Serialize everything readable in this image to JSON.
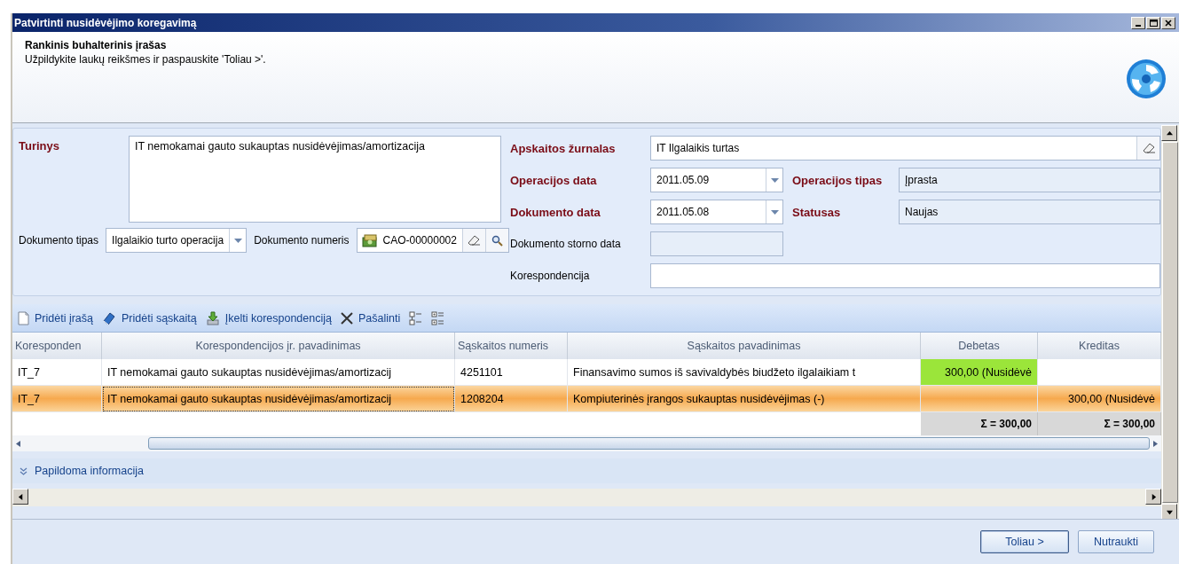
{
  "window": {
    "title": "Patvirtinti nusidėvėjimo koregavimą"
  },
  "header": {
    "title": "Rankinis buhalterinis įrašas",
    "subtitle": "Užpildykite laukų reikšmes ir paspauskite 'Toliau >'."
  },
  "form": {
    "content": {
      "label": "Turinys",
      "value": "IT nemokamai gauto sukauptas nusidėvėjimas/amortizacija",
      "required": true
    },
    "document_type": {
      "label": "Dokumento tipas",
      "value": "Ilgalaikio turto operacija",
      "required": false
    },
    "document_number": {
      "label": "Dokumento numeris",
      "value": "CAO-00000002",
      "required": false
    },
    "journal": {
      "label": "Apskaitos žurnalas",
      "value": "IT Ilgalaikis turtas",
      "required": true
    },
    "operation_date": {
      "label": "Operacijos data",
      "value": "2011.05.09",
      "required": true
    },
    "operation_type": {
      "label": "Operacijos tipas",
      "value": "Įprasta",
      "required": true,
      "disabled": true
    },
    "document_date": {
      "label": "Dokumento data",
      "value": "2011.05.08",
      "required": true
    },
    "status": {
      "label": "Statusas",
      "value": "Naujas",
      "required": true,
      "disabled": true
    },
    "storno_date": {
      "label": "Dokumento storno data",
      "required": false,
      "disabled": true
    },
    "correspondence": {
      "label": "Korespondencija",
      "required": false,
      "disabled": false
    }
  },
  "toolbar": [
    {
      "kind": "add-record",
      "label": "Pridėti įrašą"
    },
    {
      "kind": "add-account",
      "label": "Pridėti sąskaitą"
    },
    {
      "kind": "import",
      "label": "Įkelti korespondenciją"
    },
    {
      "kind": "delete",
      "label": "Pašalinti"
    },
    {
      "kind": "expand-all"
    },
    {
      "kind": "collapse-all"
    }
  ],
  "table": {
    "columns": [
      "Koresponden",
      "Korespondencijos įr. pavadinimas",
      "Sąskaitos numeris",
      "Sąskaitos pavadinimas",
      "Debetas",
      "Kreditas"
    ],
    "rows": [
      {
        "selected": false,
        "debit_highlighted": true,
        "cells": [
          "IT_7",
          "IT nemokamai gauto sukauptas nusidėvėjimas/amortizacij",
          "4251101",
          "Finansavimo sumos iš savivaldybės biudžeto ilgalaikiam t",
          "300,00 (Nusidėvė",
          ""
        ]
      },
      {
        "selected": true,
        "debit_highlighted": false,
        "cells": [
          "IT_7",
          "IT nemokamai gauto sukauptas nusidėvėjimas/amortizacij",
          "1208204",
          "Kompiuterinės įrangos sukauptas nusidėvėjimas (-)",
          "",
          "300,00 (Nusidėvė"
        ]
      }
    ],
    "totals": [
      "Σ = 300,00",
      "Σ = 300,00"
    ]
  },
  "details": {
    "label": "Papildoma informacija",
    "expanded": false
  },
  "buttons": [
    {
      "label": "Toliau >",
      "default": true
    },
    {
      "label": "Nutraukti",
      "default": false
    }
  ]
}
